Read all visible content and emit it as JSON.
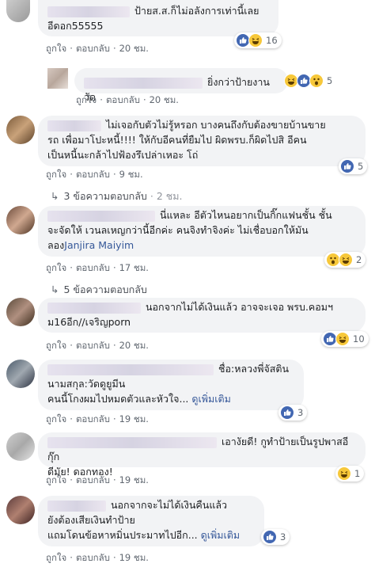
{
  "actions": {
    "like": "ถูกใจ",
    "reply": "ตอบกลับ",
    "dot": "·"
  },
  "comments": [
    {
      "text": "ป้ายส.ส.ก็ไม่อลังการเท่านี้เลย\nอีดอก55555",
      "reactions": [
        "like",
        "haha"
      ],
      "count": "16",
      "time": "20 ชม."
    },
    {
      "text": "ยิ่งกว่าป้ายงานวัด",
      "reactions": [
        "haha",
        "like",
        "wow"
      ],
      "count": "5",
      "time": "20 ชม."
    },
    {
      "text": "ไม่เจอกับตัวไม่รู้หรอก บางคนถึงกับต้องขายบ้านขาย\nรถ เพื่อมาโปะหนี้!!!! ให้กับอีคนที่ยืมไป ผิดพรบ.ก็ผิดไปสิ อีคน\nเป็นหนี้นะกล้าไปฟ้องรึเปล่าเหอะ โถ่",
      "reactions": [
        "like"
      ],
      "count": "5",
      "time": "9 ชม."
    },
    {
      "text": "นี่แหละ อีตัวไหนอยากเป็นกิ๊กแฟนชั้น ชั้น\nจะจัดให้ เวนลเหญกว่านี้อีกค่ะ คนจิงทำจิงค่ะ ไม่เชื่อบอกให้มัน\nลอง",
      "tag": "Janjira Maiyim",
      "reactions": [
        "wow",
        "haha"
      ],
      "count": "2",
      "time": "17 ชม."
    },
    {
      "text": "นอกจากไม่ได้เงินแล้ว อาจจะเจอ พรบ.คอมฯ\nม16อีก//เจริญporn",
      "reactions": [
        "like",
        "haha"
      ],
      "count": "10",
      "time": "20 ชม."
    },
    {
      "text": "ชื่อ:หลวงพี่จัสติน\nนามสกุล:วัดดูยูมีน\nคนนี้โกงผมไปหมดตัวและหัวใจ...",
      "more": "ดูเพิ่มเติม",
      "reactions": [
        "like"
      ],
      "count": "3",
      "time": "19 ชม."
    },
    {
      "text": "เอางัยดี! กูทำป้ายเป็นรูปพาสอีกุ๊ก\nดีมัย! ดอกทอง!",
      "reactions": [
        "haha"
      ],
      "count": "1",
      "time": "19 ชม."
    },
    {
      "text": "นอกจากจะไม่ได้เงินคืนแล้ว\nยังต้องเสียเงินทำป้าย\nแถมโดนข้อหาหมิ่นประมาทไปอีก...",
      "more": "ดูเพิ่มเติม",
      "reactions": [
        "like"
      ],
      "count": "3",
      "time": "19 ชม."
    }
  ],
  "reply_threads": [
    {
      "label": "3 ข้อความตอบกลับ",
      "time": "2 ชม."
    },
    {
      "label": "5 ข้อความตอบกลับ"
    }
  ]
}
